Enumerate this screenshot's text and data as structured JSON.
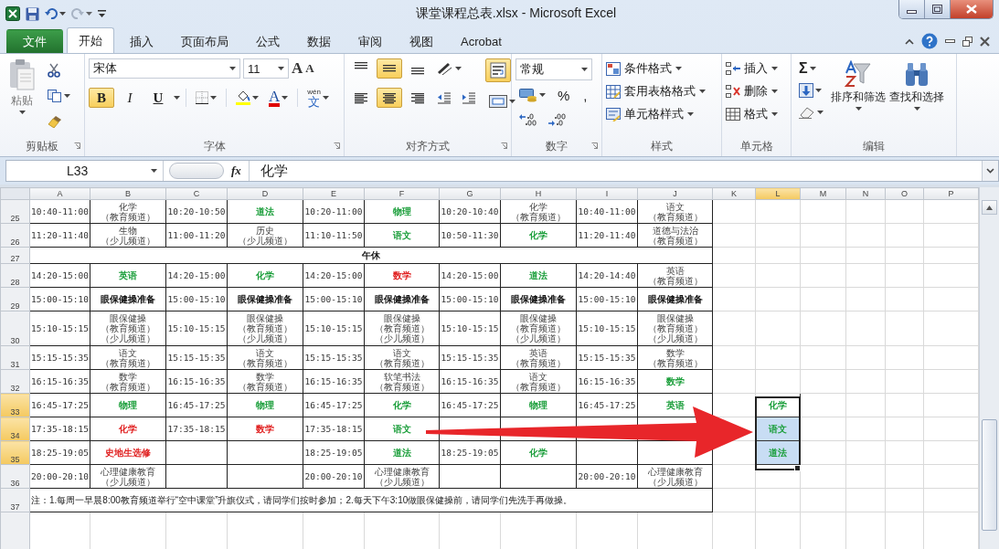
{
  "title_bar": {
    "title": "课堂课程总表.xlsx - Microsoft Excel"
  },
  "tabs": [
    {
      "label": "文件",
      "kind": "file",
      "selected": false
    },
    {
      "label": "开始",
      "kind": "tab",
      "selected": true
    },
    {
      "label": "插入",
      "kind": "tab",
      "selected": false
    },
    {
      "label": "页面布局",
      "kind": "tab",
      "selected": false
    },
    {
      "label": "公式",
      "kind": "tab",
      "selected": false
    },
    {
      "label": "数据",
      "kind": "tab",
      "selected": false
    },
    {
      "label": "审阅",
      "kind": "tab",
      "selected": false
    },
    {
      "label": "视图",
      "kind": "tab",
      "selected": false
    },
    {
      "label": "Acrobat",
      "kind": "tab",
      "selected": false
    }
  ],
  "ribbon": {
    "clipboard": {
      "label": "剪贴板",
      "paste": "粘贴"
    },
    "font": {
      "label": "字体",
      "font_name": "宋体",
      "font_size": "11",
      "grow": "A",
      "shrink": "A",
      "styles": [
        {
          "label": "B",
          "kind": "bold",
          "on": true
        },
        {
          "label": "I",
          "kind": "italic",
          "on": false
        },
        {
          "label": "U",
          "kind": "underline",
          "on": false
        }
      ],
      "font_color": "A",
      "phonetic_top": "wén",
      "phonetic_char": "文"
    },
    "alignment": {
      "label": "对齐方式",
      "wrap_text": {
        "on": true
      },
      "vertical": [
        {
          "kind": "top",
          "on": false
        },
        {
          "kind": "middle",
          "on": true
        },
        {
          "kind": "bottom",
          "on": false
        }
      ],
      "horizontal": [
        {
          "kind": "left",
          "on": false
        },
        {
          "kind": "center",
          "on": true
        },
        {
          "kind": "right",
          "on": false
        }
      ]
    },
    "number": {
      "label": "数字",
      "format": "常规",
      "symbols": [
        "%",
        ","
      ]
    },
    "styles": {
      "label": "样式",
      "items": [
        "条件格式",
        "套用表格格式",
        "单元格样式"
      ]
    },
    "cells": {
      "label": "单元格",
      "items": [
        "插入",
        "删除",
        "格式"
      ]
    },
    "editing": {
      "label": "编辑",
      "autosum": "Σ",
      "items": [
        "排序和筛选",
        "查找和选择"
      ]
    }
  },
  "formula_bar": {
    "name_box": "L33",
    "fx": "fx",
    "content": "化学"
  },
  "grid": {
    "columns": [
      {
        "label": "A",
        "selected": false
      },
      {
        "label": "B",
        "selected": false
      },
      {
        "label": "C",
        "selected": false
      },
      {
        "label": "D",
        "selected": false
      },
      {
        "label": "E",
        "selected": false
      },
      {
        "label": "F",
        "selected": false
      },
      {
        "label": "G",
        "selected": false
      },
      {
        "label": "H",
        "selected": false
      },
      {
        "label": "I",
        "selected": false
      },
      {
        "label": "J",
        "selected": false
      },
      {
        "label": "K",
        "selected": false
      },
      {
        "label": "L",
        "selected": true
      },
      {
        "label": "M",
        "selected": false
      },
      {
        "label": "N",
        "selected": false
      },
      {
        "label": "O",
        "selected": false
      },
      {
        "label": "P",
        "selected": false
      }
    ],
    "rows": [
      {
        "number": "25",
        "selected": false,
        "kind": "cells",
        "cells": [
          {
            "text": "10:40-11:00",
            "kind": "time"
          },
          {
            "lines": [
              "化学",
              "（教育频道）"
            ],
            "kind": "plain"
          },
          {
            "text": "10:20-10:50",
            "kind": "time"
          },
          {
            "text": "道法",
            "kind": "green"
          },
          {
            "text": "10:20-11:00",
            "kind": "time"
          },
          {
            "text": "物理",
            "kind": "green"
          },
          {
            "text": "10:20-10:40",
            "kind": "time"
          },
          {
            "lines": [
              "化学",
              "（教育频道）"
            ],
            "kind": "plain"
          },
          {
            "text": "10:40-11:00",
            "kind": "time"
          },
          {
            "lines": [
              "语文",
              "（教育频道）"
            ],
            "kind": "plain"
          }
        ]
      },
      {
        "number": "26",
        "selected": false,
        "kind": "cells",
        "cells": [
          {
            "text": "11:20-11:40",
            "kind": "time"
          },
          {
            "lines": [
              "生物",
              "（少儿频道）"
            ],
            "kind": "plain"
          },
          {
            "text": "11:00-11:20",
            "kind": "time"
          },
          {
            "lines": [
              "历史",
              "（少儿频道）"
            ],
            "kind": "plain"
          },
          {
            "text": "11:10-11:50",
            "kind": "time"
          },
          {
            "text": "语文",
            "kind": "green"
          },
          {
            "text": "10:50-11:30",
            "kind": "time"
          },
          {
            "text": "化学",
            "kind": "green"
          },
          {
            "text": "11:20-11:40",
            "kind": "time"
          },
          {
            "lines": [
              "道德与法治",
              "（教育频道）"
            ],
            "kind": "plain"
          }
        ]
      },
      {
        "number": "27",
        "selected": false,
        "kind": "merged",
        "merged": {
          "text": "午休",
          "kind": "heading"
        }
      },
      {
        "number": "28",
        "selected": false,
        "kind": "cells",
        "cells": [
          {
            "text": "14:20-15:00",
            "kind": "time"
          },
          {
            "text": "英语",
            "kind": "green"
          },
          {
            "text": "14:20-15:00",
            "kind": "time"
          },
          {
            "text": "化学",
            "kind": "green"
          },
          {
            "text": "14:20-15:00",
            "kind": "time"
          },
          {
            "text": "数学",
            "kind": "red"
          },
          {
            "text": "14:20-15:00",
            "kind": "time"
          },
          {
            "text": "道法",
            "kind": "green"
          },
          {
            "text": "14:20-14:40",
            "kind": "time"
          },
          {
            "lines": [
              "英语",
              "（教育频道）"
            ],
            "kind": "plain"
          }
        ]
      },
      {
        "number": "29",
        "selected": false,
        "kind": "cells",
        "cells": [
          {
            "text": "15:00-15:10",
            "kind": "time"
          },
          {
            "text": "眼保健操准备",
            "kind": "bold"
          },
          {
            "text": "15:00-15:10",
            "kind": "time"
          },
          {
            "text": "眼保健操准备",
            "kind": "bold"
          },
          {
            "text": "15:00-15:10",
            "kind": "time"
          },
          {
            "text": "眼保健操准备",
            "kind": "bold"
          },
          {
            "text": "15:00-15:10",
            "kind": "time"
          },
          {
            "text": "眼保健操准备",
            "kind": "bold"
          },
          {
            "text": "15:00-15:10",
            "kind": "time"
          },
          {
            "text": "眼保健操准备",
            "kind": "bold"
          }
        ]
      },
      {
        "number": "30",
        "selected": false,
        "kind": "cells",
        "cells": [
          {
            "text": "15:10-15:15",
            "kind": "time"
          },
          {
            "lines": [
              "眼保健操",
              "（教育频道）",
              "（少儿频道）"
            ],
            "kind": "plain"
          },
          {
            "text": "15:10-15:15",
            "kind": "time"
          },
          {
            "lines": [
              "眼保健操",
              "（教育频道）",
              "（少儿频道）"
            ],
            "kind": "plain"
          },
          {
            "text": "15:10-15:15",
            "kind": "time"
          },
          {
            "lines": [
              "眼保健操",
              "（教育频道）",
              "（少儿频道）"
            ],
            "kind": "plain"
          },
          {
            "text": "15:10-15:15",
            "kind": "time"
          },
          {
            "lines": [
              "眼保健操",
              "（教育频道）",
              "（少儿频道）"
            ],
            "kind": "plain"
          },
          {
            "text": "15:10-15:15",
            "kind": "time"
          },
          {
            "lines": [
              "眼保健操",
              "（教育频道）",
              "（少儿频道）"
            ],
            "kind": "plain"
          }
        ]
      },
      {
        "number": "31",
        "selected": false,
        "kind": "cells",
        "cells": [
          {
            "text": "15:15-15:35",
            "kind": "time"
          },
          {
            "lines": [
              "语文",
              "（教育频道）"
            ],
            "kind": "plain"
          },
          {
            "text": "15:15-15:35",
            "kind": "time"
          },
          {
            "lines": [
              "语文",
              "（教育频道）"
            ],
            "kind": "plain"
          },
          {
            "text": "15:15-15:35",
            "kind": "time"
          },
          {
            "lines": [
              "语文",
              "（教育频道）"
            ],
            "kind": "plain"
          },
          {
            "text": "15:15-15:35",
            "kind": "time"
          },
          {
            "lines": [
              "英语",
              "（教育频道）"
            ],
            "kind": "plain"
          },
          {
            "text": "15:15-15:35",
            "kind": "time"
          },
          {
            "lines": [
              "数学",
              "（教育频道）"
            ],
            "kind": "plain"
          }
        ]
      },
      {
        "number": "32",
        "selected": false,
        "kind": "cells",
        "cells": [
          {
            "text": "16:15-16:35",
            "kind": "time"
          },
          {
            "lines": [
              "数学",
              "（教育频道）"
            ],
            "kind": "plain"
          },
          {
            "text": "16:15-16:35",
            "kind": "time"
          },
          {
            "lines": [
              "数学",
              "（教育频道）"
            ],
            "kind": "plain"
          },
          {
            "text": "16:15-16:35",
            "kind": "time"
          },
          {
            "lines": [
              "软笔书法",
              "（教育频道）"
            ],
            "kind": "plain"
          },
          {
            "text": "16:15-16:35",
            "kind": "time"
          },
          {
            "lines": [
              "语文",
              "（教育频道）"
            ],
            "kind": "plain"
          },
          {
            "text": "16:15-16:35",
            "kind": "time"
          },
          {
            "text": "数学",
            "kind": "green"
          }
        ]
      },
      {
        "number": "33",
        "selected": true,
        "kind": "cells",
        "cells": [
          {
            "text": "16:45-17:25",
            "kind": "time"
          },
          {
            "text": "物理",
            "kind": "green"
          },
          {
            "text": "16:45-17:25",
            "kind": "time"
          },
          {
            "text": "物理",
            "kind": "green"
          },
          {
            "text": "16:45-17:25",
            "kind": "time"
          },
          {
            "text": "化学",
            "kind": "green"
          },
          {
            "text": "16:45-17:25",
            "kind": "time"
          },
          {
            "text": "物理",
            "kind": "green"
          },
          {
            "text": "16:45-17:25",
            "kind": "time"
          },
          {
            "text": "英语",
            "kind": "green"
          }
        ],
        "column_l": {
          "text": "化学",
          "kind": "green",
          "selected": false
        }
      },
      {
        "number": "34",
        "selected": true,
        "kind": "cells",
        "cells": [
          {
            "text": "17:35-18:15",
            "kind": "time"
          },
          {
            "text": "化学",
            "kind": "red"
          },
          {
            "text": "17:35-18:15",
            "kind": "time"
          },
          {
            "text": "数学",
            "kind": "red"
          },
          {
            "text": "17:35-18:15",
            "kind": "time"
          },
          {
            "text": "语文",
            "kind": "green"
          },
          null,
          null,
          null,
          null
        ],
        "column_l": {
          "text": "语文",
          "kind": "green",
          "selected": true
        }
      },
      {
        "number": "35",
        "selected": true,
        "kind": "cells",
        "cells": [
          {
            "text": "18:25-19:05",
            "kind": "time"
          },
          {
            "text": "史地生选修",
            "kind": "red"
          },
          null,
          null,
          {
            "text": "18:25-19:05",
            "kind": "time"
          },
          {
            "text": "道法",
            "kind": "green"
          },
          {
            "text": "18:25-19:05",
            "kind": "time"
          },
          {
            "text": "化学",
            "kind": "green"
          },
          null,
          null
        ],
        "column_l": {
          "text": "道法",
          "kind": "green",
          "selected": true
        }
      },
      {
        "number": "36",
        "selected": false,
        "kind": "cells",
        "cells": [
          {
            "text": "20:00-20:10",
            "kind": "time"
          },
          {
            "lines": [
              "心理健康教育",
              "（少儿频道）"
            ],
            "kind": "plain"
          },
          null,
          null,
          {
            "text": "20:00-20:10",
            "kind": "time"
          },
          {
            "lines": [
              "心理健康教育",
              "（少儿频道）"
            ],
            "kind": "plain"
          },
          null,
          null,
          {
            "text": "20:00-20:10",
            "kind": "time"
          },
          {
            "lines": [
              "心理健康教育",
              "（少儿频道）"
            ],
            "kind": "plain"
          }
        ]
      },
      {
        "number": "37",
        "selected": false,
        "kind": "merged",
        "merged": {
          "text": "注：1.每周一早晨8:00教育频道举行“空中课堂”升旗仪式，请同学们按时参加；2.每天下午3:10做眼保健操前，请同学们先洗手再做操。",
          "kind": "note"
        }
      }
    ]
  }
}
